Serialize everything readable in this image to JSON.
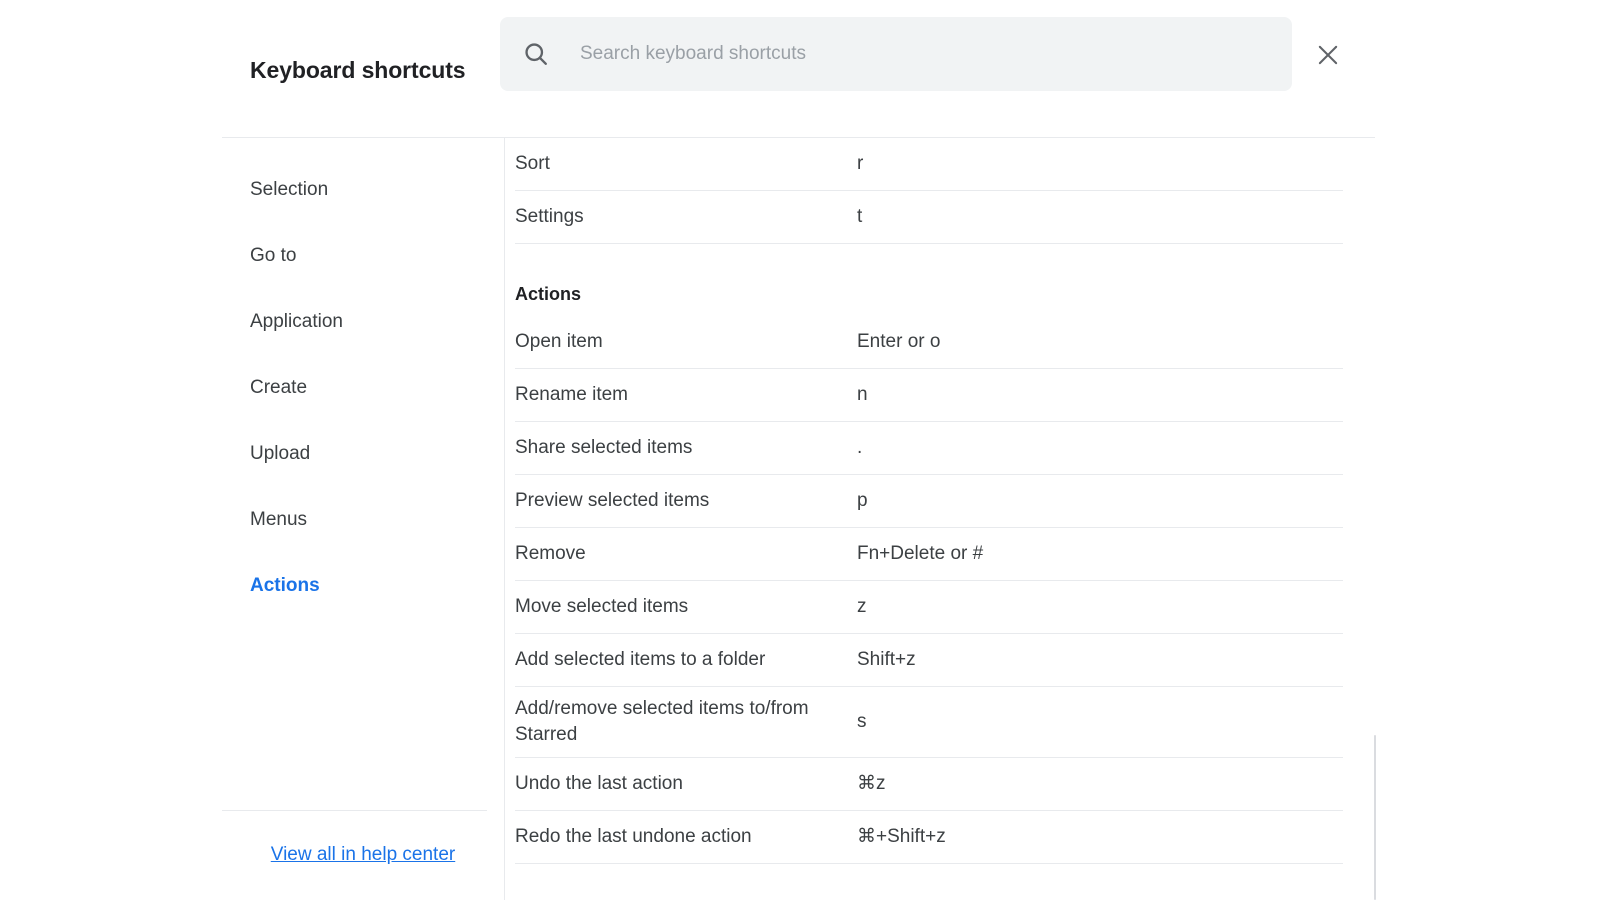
{
  "header": {
    "title": "Keyboard shortcuts",
    "search": {
      "placeholder": "Search keyboard shortcuts",
      "value": "",
      "icon": "search-icon"
    },
    "close": {
      "icon": "close-icon",
      "label": "Close"
    }
  },
  "sidebar": {
    "items": [
      {
        "label": "Selection",
        "active": false
      },
      {
        "label": "Go to",
        "active": false
      },
      {
        "label": "Application",
        "active": false
      },
      {
        "label": "Create",
        "active": false
      },
      {
        "label": "Upload",
        "active": false
      },
      {
        "label": "Menus",
        "active": false
      },
      {
        "label": "Actions",
        "active": true
      }
    ],
    "footer_link": "View all in help center"
  },
  "content": {
    "blocks": [
      {
        "type": "row",
        "desc": "Sort",
        "keys": "r"
      },
      {
        "type": "row",
        "desc": "Settings",
        "keys": "t"
      },
      {
        "type": "heading",
        "label": "Actions"
      },
      {
        "type": "row",
        "desc": "Open item",
        "keys": "Enter or o"
      },
      {
        "type": "row",
        "desc": "Rename item",
        "keys": "n"
      },
      {
        "type": "row",
        "desc": "Share selected items",
        "keys": "."
      },
      {
        "type": "row",
        "desc": "Preview selected items",
        "keys": "p"
      },
      {
        "type": "row",
        "desc": "Remove",
        "keys": "Fn+Delete or #"
      },
      {
        "type": "row",
        "desc": "Move selected items",
        "keys": "z"
      },
      {
        "type": "row",
        "desc": "Add selected items to a folder",
        "keys": "Shift+z"
      },
      {
        "type": "row",
        "desc": "Add/remove selected items to/from Starred",
        "keys": "s",
        "tall": true
      },
      {
        "type": "row",
        "desc": "Undo the last action",
        "keys": "⌘z"
      },
      {
        "type": "row",
        "desc": "Redo the last undone action",
        "keys": "⌘+Shift+z"
      }
    ]
  },
  "colors": {
    "accent": "#1a73e8",
    "text": "#3c4043",
    "heading": "#202124",
    "divider": "#e8eaed",
    "search_bg": "#f1f3f4",
    "placeholder": "#9aa0a6",
    "scrollbar": "#dadce0"
  }
}
